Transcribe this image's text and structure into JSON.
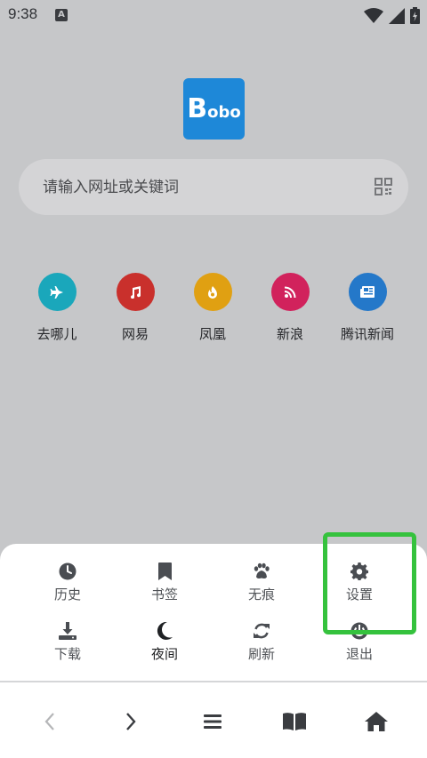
{
  "status_bar": {
    "time": "9:38",
    "notification_badge": "A",
    "icons": [
      "wifi-icon",
      "signal-icon",
      "battery-charging-icon"
    ]
  },
  "logo": {
    "big_letter": "B",
    "small_text": "obo",
    "color": "#1e88d8"
  },
  "search": {
    "placeholder": "请输入网址或关键词",
    "scan_icon": "qr-scan-icon"
  },
  "shortcuts": [
    {
      "label": "去哪儿",
      "icon": "airplane-icon",
      "color": "#1aa7bb"
    },
    {
      "label": "网易",
      "icon": "music-note-icon",
      "color": "#c9302c"
    },
    {
      "label": "凤凰",
      "icon": "fire-icon",
      "color": "#e0a012"
    },
    {
      "label": "新浪",
      "icon": "rss-icon",
      "color": "#d1225c"
    },
    {
      "label": "腾讯新闻",
      "icon": "newspaper-icon",
      "color": "#2478c9"
    }
  ],
  "menu": {
    "items": [
      {
        "label": "历史",
        "icon": "clock-icon"
      },
      {
        "label": "书签",
        "icon": "bookmark-icon"
      },
      {
        "label": "无痕",
        "icon": "paw-icon"
      },
      {
        "label": "设置",
        "icon": "gear-icon"
      },
      {
        "label": "下载",
        "icon": "download-icon"
      },
      {
        "label": "夜间",
        "icon": "moon-icon"
      },
      {
        "label": "刷新",
        "icon": "refresh-icon"
      },
      {
        "label": "退出",
        "icon": "power-icon"
      }
    ]
  },
  "navbar": {
    "buttons": [
      "back-icon",
      "forward-icon",
      "menu-icon",
      "book-icon",
      "home-icon"
    ]
  },
  "highlight_color": "#35c23d"
}
